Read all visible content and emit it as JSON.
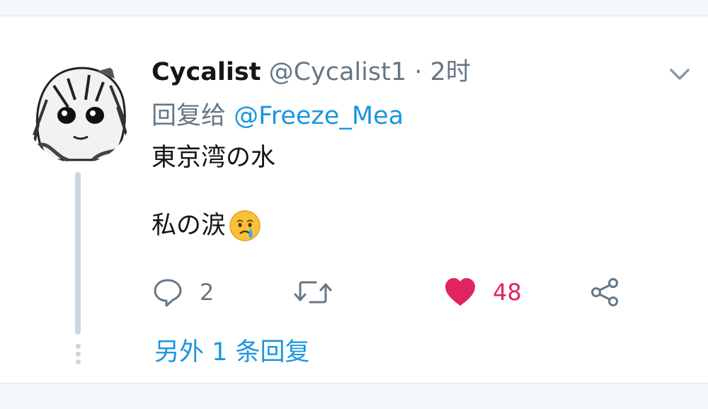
{
  "tweet": {
    "display_name": "Cycalist",
    "handle": "@Cycalist1",
    "separator": "·",
    "time": "2时",
    "reply_prefix": "回复给",
    "reply_to": "@Freeze_Mea",
    "text_line1": "東京湾の水",
    "text_line2": "私の涙",
    "emoji": "crying-face-emoji",
    "reply_count": "2",
    "like_count": "48",
    "liked": true,
    "more_replies": "另外 1 条回复"
  },
  "colors": {
    "link": "#1b95e0",
    "like": "#e0245e",
    "muted": "#657786",
    "text": "#14171a",
    "thread_line": "#ccd6dd"
  },
  "icons": [
    "avatar-image",
    "caret-down-icon",
    "reply-icon",
    "retweet-icon",
    "heart-icon",
    "share-icon"
  ]
}
